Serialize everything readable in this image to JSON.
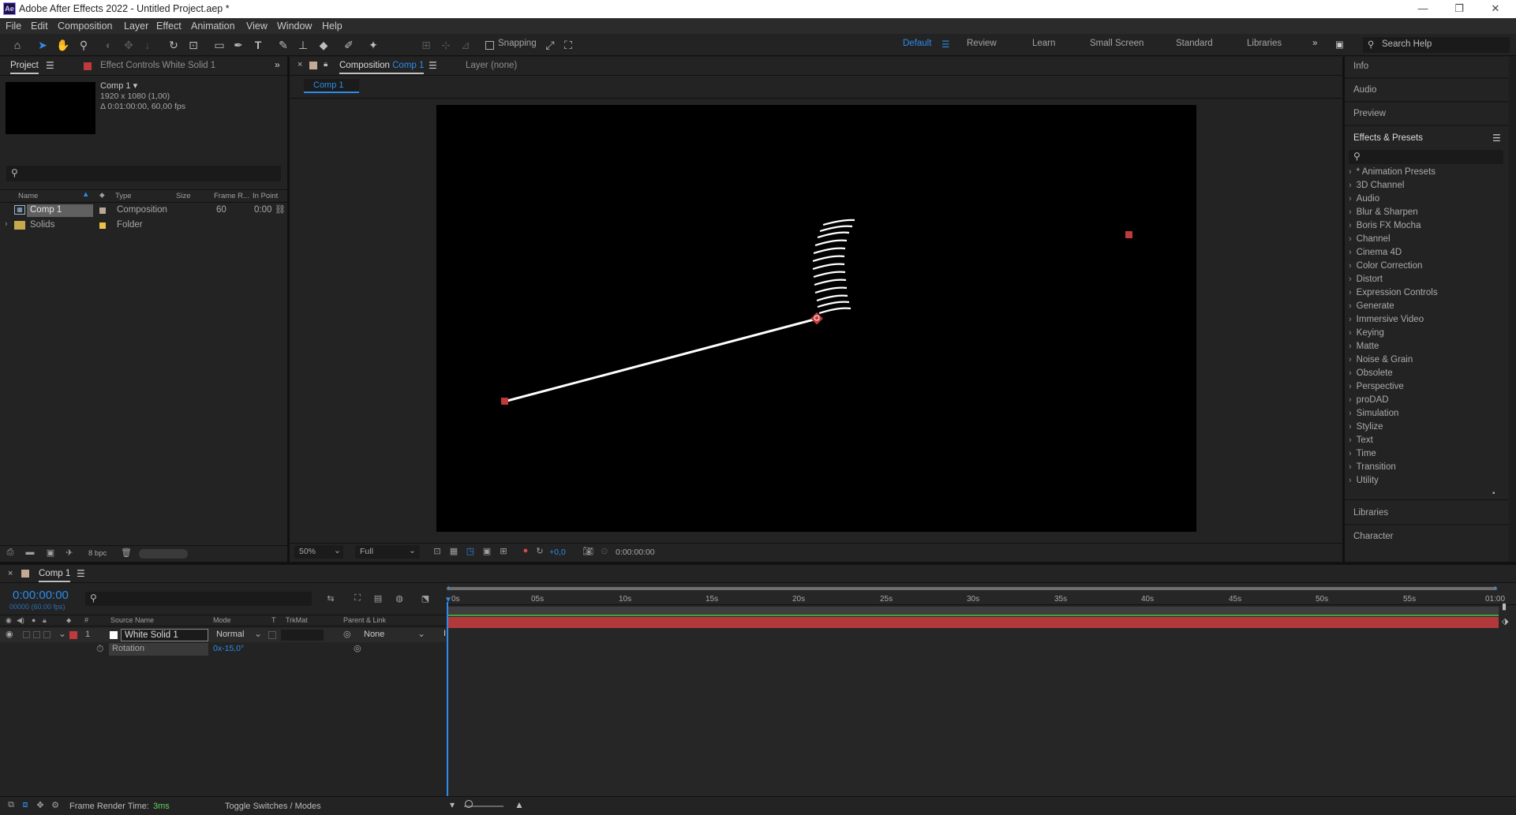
{
  "app": {
    "title": "Adobe After Effects 2022 - Untitled Project.aep *",
    "logo": "Ae"
  },
  "window_controls": {
    "minimize": "—",
    "maximize": "❐",
    "close": "✕"
  },
  "menu": [
    "File",
    "Edit",
    "Composition",
    "Layer",
    "Effect",
    "Animation",
    "View",
    "Window",
    "Help"
  ],
  "toolbar": {
    "snapping_label": "Snapping",
    "workspaces": [
      "Default",
      "Review",
      "Learn",
      "Small Screen",
      "Standard",
      "Libraries"
    ],
    "active_workspace": "Default",
    "search_placeholder": "Search Help"
  },
  "project_panel": {
    "tab_project": "Project",
    "tab_effect_controls": "Effect Controls White Solid 1",
    "comp_name": "Comp 1 ▾",
    "comp_res": "1920 x 1080 (1,00)",
    "comp_duration": "Δ 0:01:00:00, 60,00 fps",
    "columns": [
      "Name",
      "Type",
      "Size",
      "Frame R...",
      "In Point"
    ],
    "items": [
      {
        "name": "Comp 1",
        "type": "Composition",
        "size": "",
        "fps": "60",
        "in": "0:00",
        "color": "#b7a793"
      },
      {
        "name": "Solids",
        "type": "Folder",
        "size": "",
        "fps": "",
        "in": "",
        "color": "#e8c14a"
      }
    ],
    "bpc": "8 bpc"
  },
  "comp_panel": {
    "tab_prefix": "Composition",
    "tab_name": "Comp 1",
    "layer_tab": "Layer (none)",
    "breadcrumb": "Comp 1",
    "zoom": "50%",
    "resolution": "Full",
    "exposure": "+0,0",
    "timecode": "0:00:00:00"
  },
  "right_panel": {
    "info": "Info",
    "audio": "Audio",
    "preview": "Preview",
    "effects_title": "Effects & Presets",
    "categories": [
      "* Animation Presets",
      "3D Channel",
      "Audio",
      "Blur & Sharpen",
      "Boris FX Mocha",
      "Channel",
      "Cinema 4D",
      "Color Correction",
      "Distort",
      "Expression Controls",
      "Generate",
      "Immersive Video",
      "Keying",
      "Matte",
      "Noise & Grain",
      "Obsolete",
      "Perspective",
      "proDAD",
      "Simulation",
      "Stylize",
      "Text",
      "Time",
      "Transition",
      "Utility"
    ],
    "libraries": "Libraries",
    "character": "Character"
  },
  "timeline": {
    "tab": "Comp 1",
    "timecode": "0:00:00:00",
    "frames": "00000 (60.00 fps)",
    "col_hash": "#",
    "col_source": "Source Name",
    "col_mode": "Mode",
    "col_t": "T",
    "col_trkmat": "TrkMat",
    "col_parent": "Parent & Link",
    "ruler": [
      "0s",
      "05s",
      "10s",
      "15s",
      "20s",
      "25s",
      "30s",
      "35s",
      "40s",
      "45s",
      "50s",
      "55s",
      "01:00"
    ],
    "layer": {
      "index": "1",
      "name": "White Solid 1",
      "mode": "Normal",
      "parent": "None"
    },
    "property": {
      "name": "Rotation",
      "value": "0x-15,0°"
    },
    "frame_render_label": "Frame Render Time:",
    "frame_render_value": "3ms",
    "toggle_label": "Toggle Switches / Modes"
  },
  "colors": {
    "accent": "#2d8ceb",
    "label_red": "#c0393b",
    "layer_bar": "#c0393b"
  }
}
